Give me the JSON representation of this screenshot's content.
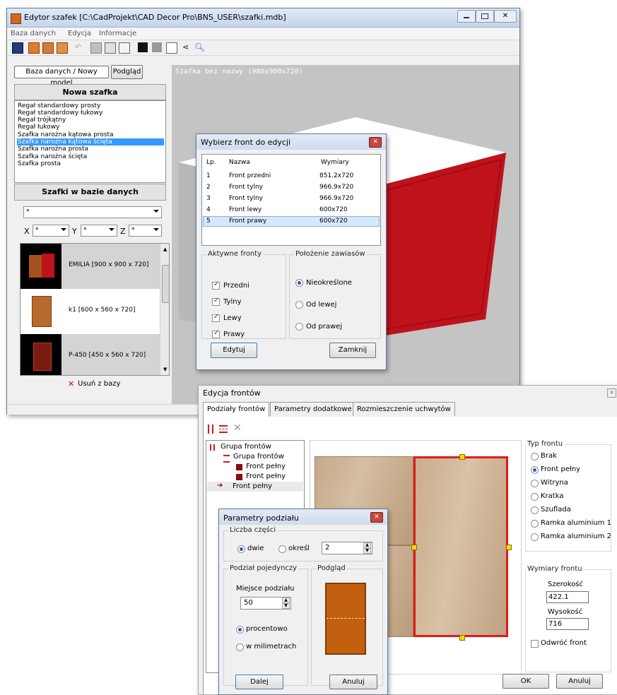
{
  "main_window": {
    "title": "Edytor szafek [C:\\CadProjekt\\CAD Decor Pro\\BNS_USER\\szafki.mdb]",
    "menu": [
      "Baza danych",
      "Edycja",
      "Informacje"
    ],
    "tabs": [
      "Baza danych / Nowy model",
      "Podgląd"
    ],
    "new_cabinet_title": "Nowa szafka",
    "new_cabinet_items": [
      "Regał standardowy prosty",
      "Regał standardowy łukowy",
      "Regał trójkątny",
      "Regał łukowy",
      "Szafka narożna kątowa prosta",
      "Szafka narożna kątowa ścięta",
      "Szafka narożna prosta",
      "Szafka narożna ścięta",
      "Szafka prosta"
    ],
    "new_cabinet_selected": "Szafka narożna kątowa ścięta",
    "db_title": "Szafki w bazie danych",
    "filter_value": "*",
    "x_label": "X",
    "y_label": "Y",
    "z_label": "Z",
    "x_value": "*",
    "y_value": "*",
    "z_value": "*",
    "db_items": [
      {
        "label": "EMILIA  [900 x 900 x 720]"
      },
      {
        "label": "k1  [600 x 560 x 720]"
      },
      {
        "label": "P-450  [450 x 560 x 720]"
      }
    ],
    "remove_label": "Usuń z bazy",
    "viewport_caption": "Szafka bez nazwy (980x980x720)",
    "colors": {
      "cabinet_front": "#c0121a",
      "cabinet_wood": "#a0521f",
      "viewport_bg": "#c4c4c4"
    }
  },
  "front_picker": {
    "title": "Wybierz front do edycji",
    "columns": [
      "Lp.",
      "Nazwa",
      "Wymiary"
    ],
    "rows": [
      {
        "lp": "1",
        "name": "Front przedni",
        "dims": "851.2x720"
      },
      {
        "lp": "2",
        "name": "Front tylny",
        "dims": "966.9x720"
      },
      {
        "lp": "3",
        "name": "Front tylny",
        "dims": "966.9x720"
      },
      {
        "lp": "4",
        "name": "Front lewy",
        "dims": "600x720"
      },
      {
        "lp": "5",
        "name": "Front prawy",
        "dims": "600x720"
      }
    ],
    "selected_row": 5,
    "active_group": "Aktywne fronty",
    "active_fronts": [
      {
        "label": "Przedni",
        "checked": true
      },
      {
        "label": "Tylny",
        "checked": true
      },
      {
        "label": "Lewy",
        "checked": true
      },
      {
        "label": "Prawy",
        "checked": true
      }
    ],
    "hinge_group": "Położenie zawiasów",
    "hinge_options": [
      {
        "label": "Nieokreślone",
        "selected": true
      },
      {
        "label": "Od lewej",
        "selected": false
      },
      {
        "label": "Od prawej",
        "selected": false
      }
    ],
    "edit_button": "Edytuj",
    "close_button": "Zamknij"
  },
  "front_editor": {
    "title": "Edycja frontów",
    "tabs": [
      "Podziały frontów",
      "Parametry dodatkowe",
      "Rozmieszczenie uchwytów"
    ],
    "tree": [
      {
        "label": "Grupa frontów",
        "level": 0
      },
      {
        "label": "Grupa frontów",
        "level": 1
      },
      {
        "label": "Front pełny",
        "level": 2
      },
      {
        "label": "Front pełny",
        "level": 2
      },
      {
        "label": "Front pełny",
        "level": 1
      }
    ],
    "type_group": "Typ frontu",
    "types": [
      {
        "label": "Brak",
        "selected": false
      },
      {
        "label": "Front pełny",
        "selected": true
      },
      {
        "label": "Witryna",
        "selected": false
      },
      {
        "label": "Kratka",
        "selected": false
      },
      {
        "label": "Szuflada",
        "selected": false
      },
      {
        "label": "Ramka aluminium 1",
        "selected": false
      },
      {
        "label": "Ramka aluminium 2",
        "selected": false
      }
    ],
    "dims_group": "Wymiary frontu",
    "width_label": "Szerokość",
    "width_value": "422.1",
    "height_label": "Wysokość",
    "height_value": "716",
    "flip_label": "Odwróć front",
    "ok_button": "OK",
    "cancel_button": "Anuluj",
    "colors": {
      "wood": "#c8ad8c",
      "highlight": "#e21a1a",
      "handle": "#ffd800"
    }
  },
  "split_dialog": {
    "title": "Parametry podziału",
    "parts_group": "Liczba części",
    "opt_two": "dwie",
    "opt_specify": "określ",
    "parts_value": "2",
    "single_group": "Podział pojedynczy",
    "preview_group": "Podgląd",
    "place_label": "Miejsce podziału",
    "place_value": "50",
    "opt_percent": "procentowo",
    "opt_mm": "w milimetrach",
    "next_button": "Dalej",
    "cancel_button": "Anuluj",
    "colors": {
      "preview": "#c3600f"
    }
  }
}
